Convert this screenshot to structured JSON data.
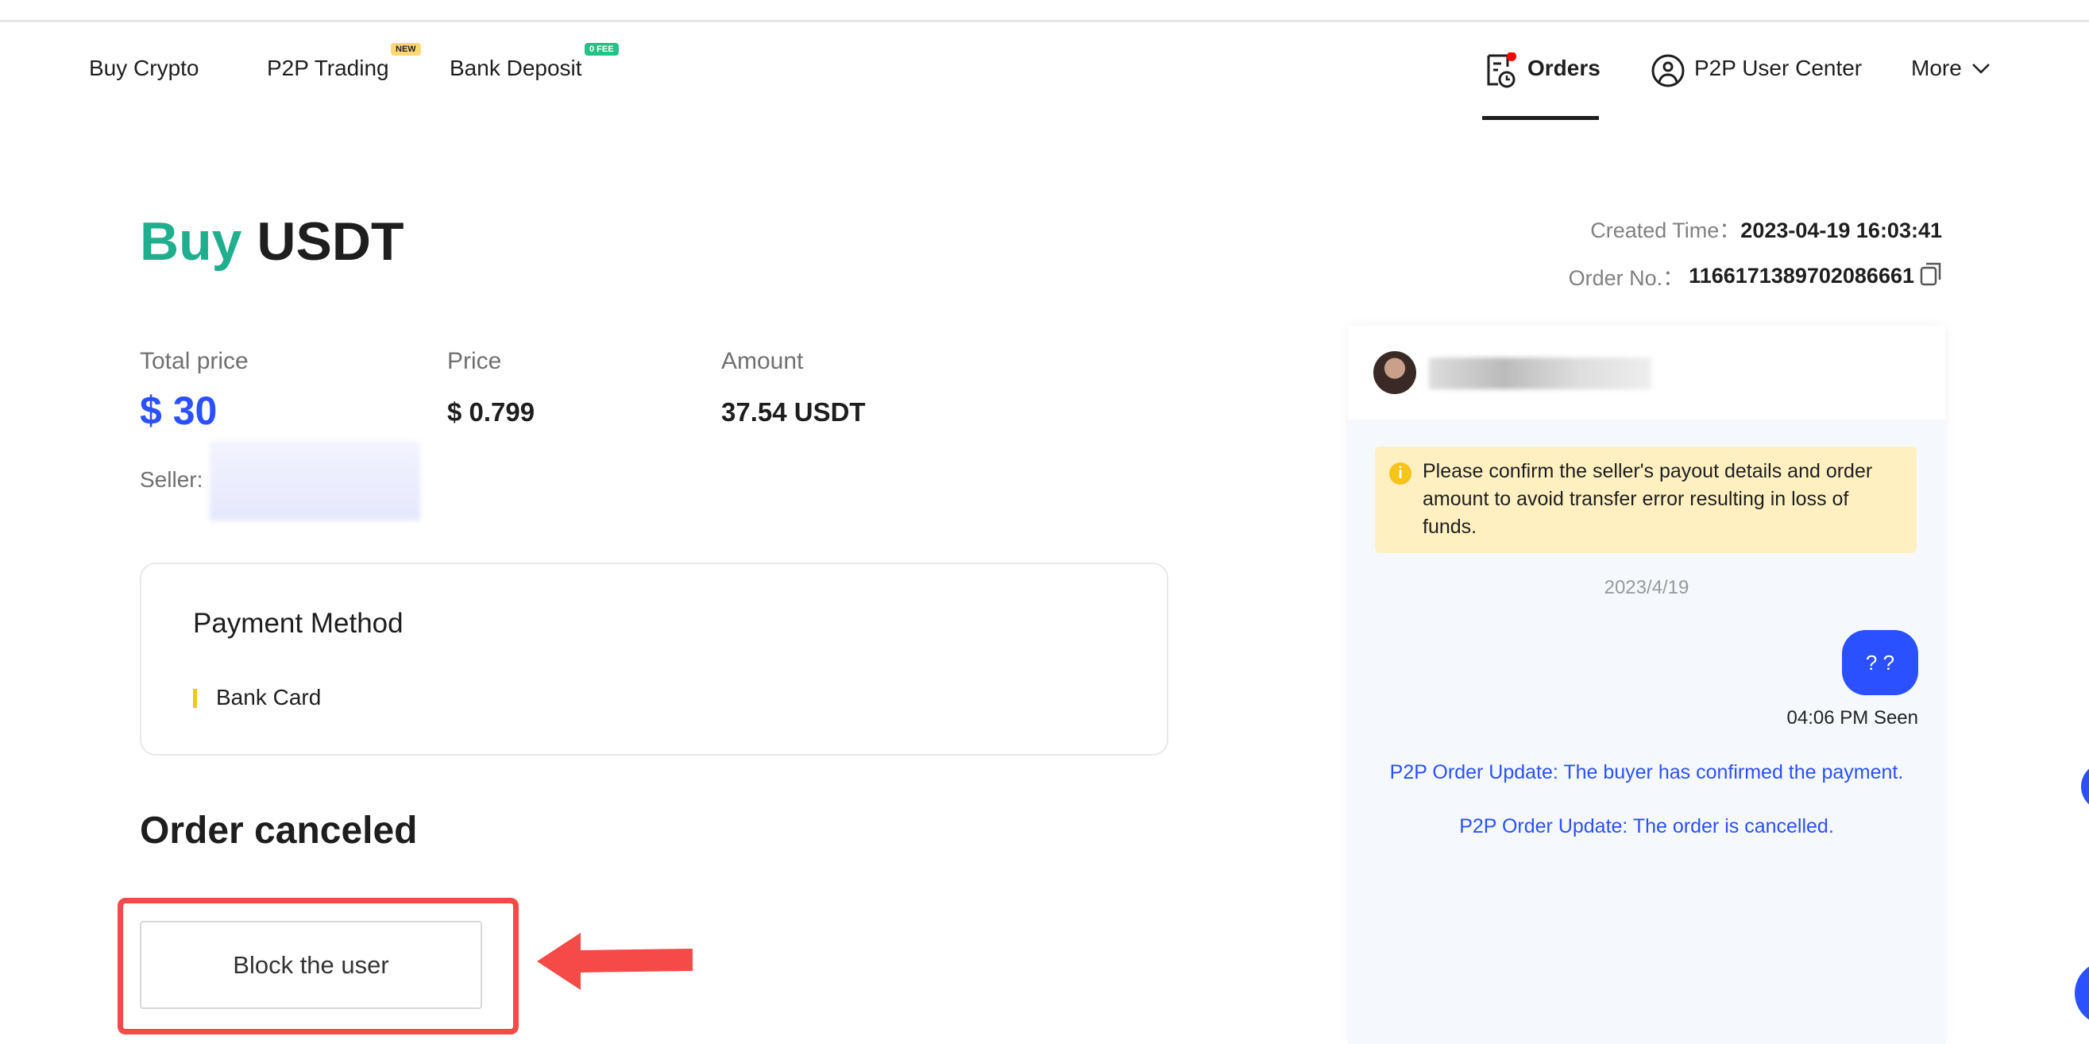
{
  "nav": {
    "buy_crypto": "Buy Crypto",
    "p2p_trading": "P2P Trading",
    "p2p_badge": "NEW",
    "bank_deposit": "Bank Deposit",
    "bank_badge": "0 FEE",
    "orders": "Orders",
    "user_center": "P2P User Center",
    "more": "More"
  },
  "order": {
    "side": "Buy",
    "asset": "USDT",
    "created_label": "Created Time：",
    "created_value": "2023-04-19 16:03:41",
    "order_no_label": "Order No.：",
    "order_no_value": "1166171389702086661",
    "total_price_label": "Total price",
    "total_price_value": "$ 30",
    "price_label": "Price",
    "price_value": "$ 0.799",
    "amount_label": "Amount",
    "amount_value": "37.54 USDT",
    "seller_label": "Seller:",
    "payment_method_title": "Payment Method",
    "payment_method": "Bank Card",
    "status": "Order canceled",
    "block_button": "Block the user"
  },
  "chat": {
    "warning": "Please confirm the seller's payout details and order amount to avoid transfer error resulting in loss of funds.",
    "date": "2023/4/19",
    "message": "? ?",
    "message_meta": "04:06 PM Seen",
    "updates": [
      "P2P Order Update: The buyer has confirmed the payment.",
      "P2P Order Update: The order is cancelled."
    ]
  },
  "colors": {
    "buy": "#1fae8e",
    "accent": "#2b50ff",
    "highlight": "#f44a48",
    "warning_bg": "#fff0c2"
  }
}
